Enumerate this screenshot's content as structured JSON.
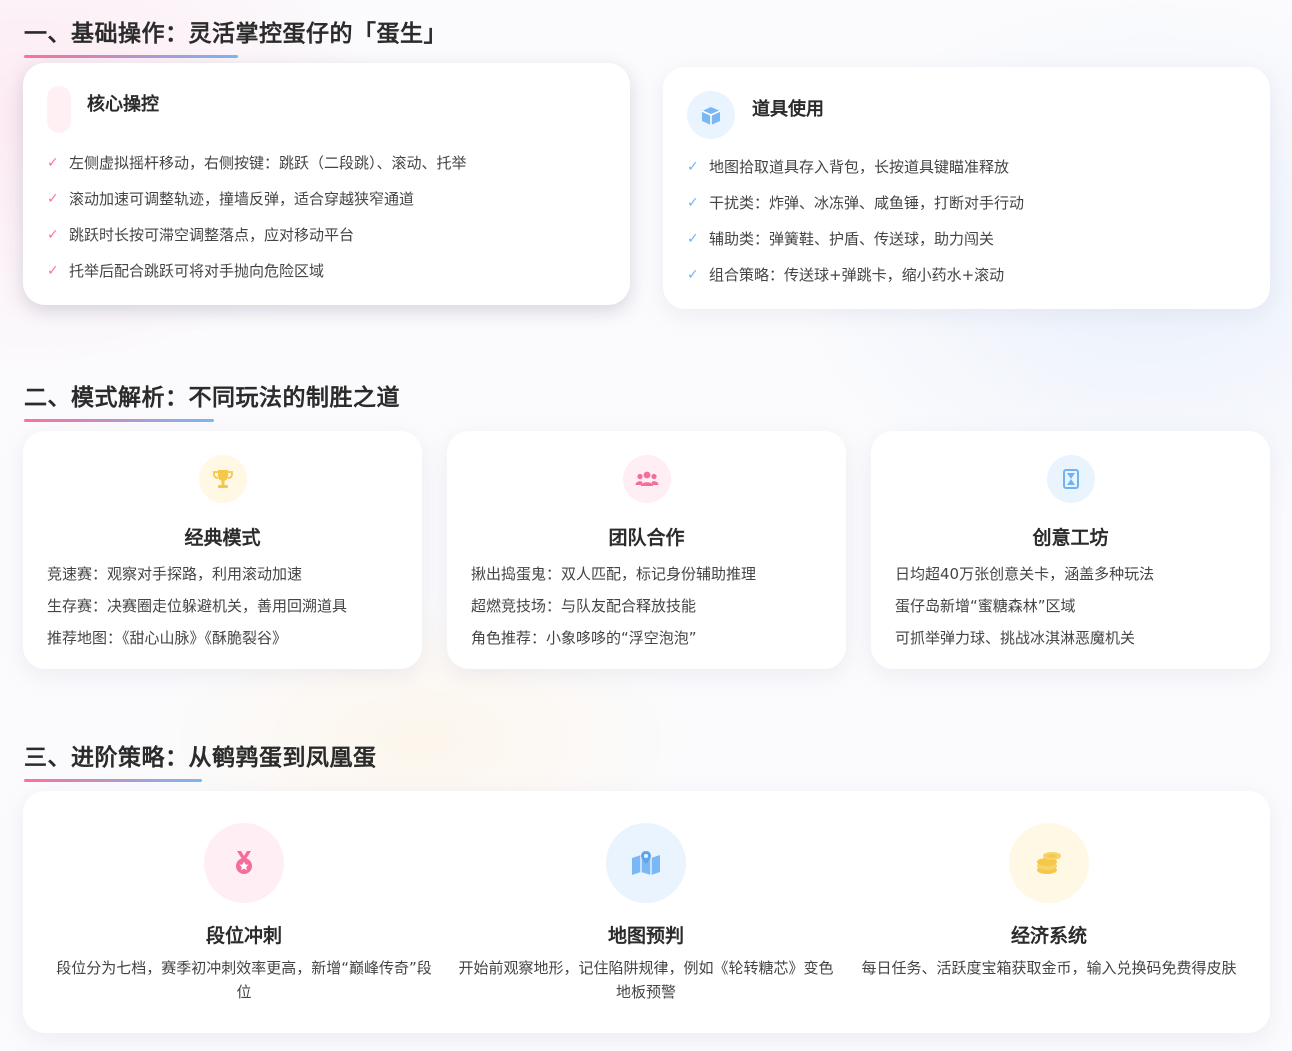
{
  "sections": {
    "basics_title": "一、基础操作：灵活掌控蛋仔的「蛋生」",
    "modes_title": "二、模式解析：不同玩法的制胜之道",
    "advanced_title": "三、进阶策略：从鹌鹑蛋到凤凰蛋"
  },
  "core_controls": {
    "title": "核心操控",
    "items": [
      "左侧虚拟摇杆移动，右侧按键：跳跃（二段跳）、滚动、托举",
      "滚动加速可调整轨迹，撞墙反弹，适合穿越狭窄通道",
      "跳跃时长按可滞空调整落点，应对移动平台",
      "托举后配合跳跃可将对手抛向危险区域"
    ]
  },
  "item_usage": {
    "title": "道具使用",
    "icon": "box-icon",
    "items": [
      "地图拾取道具存入背包，长按道具键瞄准释放",
      "干扰类：炸弹、冰冻弹、咸鱼锤，打断对手行动",
      "辅助类：弹簧鞋、护盾、传送球，助力闯关",
      "组合策略：传送球+弹跳卡，缩小药水+滚动"
    ]
  },
  "modes": [
    {
      "icon": "trophy-icon",
      "title": "经典模式",
      "lines": [
        "竞速赛：观察对手探路，利用滚动加速",
        "生存赛：决赛圈走位躲避机关，善用回溯道具",
        "推荐地图：《甜心山脉》《酥脆裂谷》"
      ]
    },
    {
      "icon": "users-icon",
      "title": "团队合作",
      "lines": [
        "揪出捣蛋鬼：双人匹配，标记身份辅助推理",
        "超燃竞技场：与队友配合释放技能",
        "角色推荐：小象哆哆的“浮空泡泡”"
      ]
    },
    {
      "icon": "hourglass-icon",
      "title": "创意工坊",
      "lines": [
        "日均超40万张创意关卡，涵盖多种玩法",
        "蛋仔岛新增“蜜糖森林”区域",
        "可抓举弹力球、挑战冰淇淋恶魔机关"
      ]
    }
  ],
  "advanced": [
    {
      "icon": "medal-icon",
      "title": "段位冲刺",
      "desc": "段位分为七档，赛季初冲刺效率更高，新增“巅峰传奇”段位"
    },
    {
      "icon": "map-icon",
      "title": "地图预判",
      "desc": "开始前观察地形，记住陷阱规律，例如《轮转糖芯》变色地板预警"
    },
    {
      "icon": "coins-icon",
      "title": "经济系统",
      "desc": "每日任务、活跃度宝箱获取金币，输入兑换码免费得皮肤"
    }
  ],
  "colors": {
    "pink": "#ff6f9f",
    "blue": "#6fb3f2",
    "gold": "#f5c74a",
    "underline_from": "#ff6f9f",
    "underline_to": "#7ab8f5"
  }
}
